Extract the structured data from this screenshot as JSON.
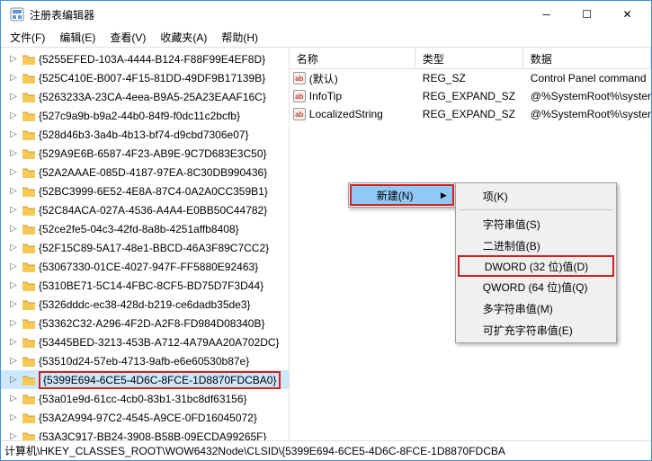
{
  "window": {
    "title": "注册表编辑器"
  },
  "menu": {
    "file": "文件(F)",
    "edit": "编辑(E)",
    "view": "查看(V)",
    "fav": "收藏夹(A)",
    "help": "帮助(H)"
  },
  "tree_items": [
    "{5255EFED-103A-4444-B124-F88F99E4EF8D}",
    "{525C410E-B007-4F15-81DD-49DF9B17139B}",
    "{5263233A-23CA-4eea-B9A5-25A23EAAF16C}",
    "{527c9a9b-b9a2-44b0-84f9-f0dc11c2bcfb}",
    "{528d46b3-3a4b-4b13-bf74-d9cbd7306e07}",
    "{529A9E6B-6587-4F23-AB9E-9C7D683E3C50}",
    "{52A2AAAE-085D-4187-97EA-8C30DB990436}",
    "{52BC3999-6E52-4E8A-87C4-0A2A0CC359B1}",
    "{52C84ACA-027A-4536-A4A4-E0BB50C44782}",
    "{52ce2fe5-04c3-42fd-8a8b-4251affb8408}",
    "{52F15C89-5A17-48e1-BBCD-46A3F89C7CC2}",
    "{53067330-01CE-4027-947F-FF5880E92463}",
    "{5310BE71-5C14-4FBC-8CF5-BD75D7F3D44}",
    "{5326dddc-ec38-428d-b219-ce6dadb35de3}",
    "{53362C32-A296-4F2D-A2F8-FD984D08340B}",
    "{53445BED-3213-453B-A712-4A79AA20A702DC}",
    "{53510d24-57eb-4713-9afb-e6e60530b87e}",
    "{5399E694-6CE5-4D6C-8FCE-1D8870FDCBA0}",
    "{53a01e9d-61cc-4cb0-83b1-31bc8df63156}",
    "{53A2A994-97C2-4545-A9CE-0FD16045072}",
    "{53A3C917-BB24-3908-B58B-09ECDA99265F}"
  ],
  "selected_index": 17,
  "list": {
    "headers": {
      "name": "名称",
      "type": "类型",
      "data": "数据"
    },
    "rows": [
      {
        "name": "(默认)",
        "type": "REG_SZ",
        "data": "Control Panel command"
      },
      {
        "name": "InfoTip",
        "type": "REG_EXPAND_SZ",
        "data": "@%SystemRoot%\\syster"
      },
      {
        "name": "LocalizedString",
        "type": "REG_EXPAND_SZ",
        "data": "@%SystemRoot%\\syster"
      }
    ]
  },
  "context1": {
    "new": "新建(N)"
  },
  "context2": {
    "key": "项(K)",
    "string": "字符串值(S)",
    "binary": "二进制值(B)",
    "dword": "DWORD (32 位)值(D)",
    "qword": "QWORD (64 位)值(Q)",
    "multi": "多字符串值(M)",
    "expand": "可扩充字符串值(E)"
  },
  "status": "计算机\\HKEY_CLASSES_ROOT\\WOW6432Node\\CLSID\\{5399E694-6CE5-4D6C-8FCE-1D8870FDCBA"
}
